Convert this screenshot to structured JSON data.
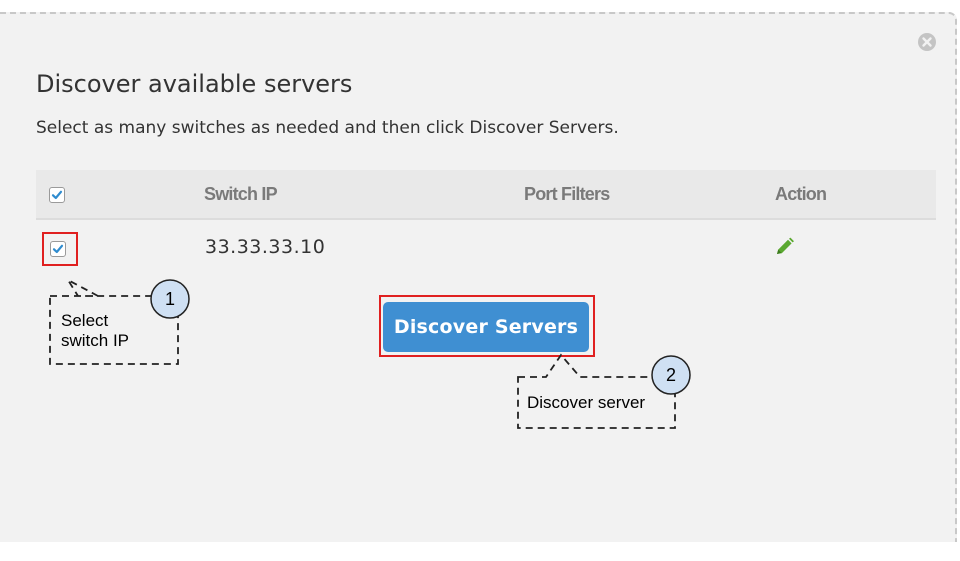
{
  "dialog": {
    "title": "Discover available servers",
    "subtitle": "Select as many switches as needed and then click Discover Servers.",
    "close_icon": "close-circle-icon"
  },
  "table": {
    "columns": [
      "Switch IP",
      "Port Filters",
      "Action"
    ],
    "header_checkbox_checked": true,
    "rows": [
      {
        "checked": true,
        "switch_ip": "33.33.33.10",
        "port_filters": "",
        "action_icon": "pencil-edit-icon"
      }
    ]
  },
  "actions": {
    "discover_label": "Discover Servers"
  },
  "callouts": [
    {
      "number": "1",
      "text_lines": [
        "Select",
        "switch IP"
      ]
    },
    {
      "number": "2",
      "text": "Discover server"
    }
  ],
  "colors": {
    "accent_button": "#3f8fd2",
    "checkbox_check": "#2f8ccf",
    "highlight": "#e02020",
    "edit_icon": "#5aa830",
    "badge_fill": "#cfe0f3"
  }
}
